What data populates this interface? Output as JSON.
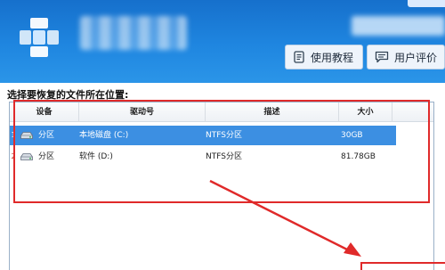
{
  "header": {
    "buttons": {
      "tutorial": "使用教程",
      "review": "用户评价"
    }
  },
  "main": {
    "prompt": "选择要恢复的文件所在位置:",
    "table": {
      "columns": [
        "设备",
        "驱动号",
        "描述",
        "大小"
      ],
      "rows": [
        {
          "index": "1",
          "device": "分区",
          "drive": "本地磁盘 (C:)",
          "description": "NTFS分区",
          "size": "30GB",
          "selected": true
        },
        {
          "index": "2",
          "device": "分区",
          "drive": "软件 (D:)",
          "description": "NTFS分区",
          "size": "81.78GB",
          "selected": false
        }
      ]
    }
  },
  "colors": {
    "header_blue": "#1f86e0",
    "selection_blue": "#3c8fe2",
    "annotation_red": "#e02a2a"
  },
  "icons": [
    "app-logo-icon",
    "book-icon",
    "chat-icon",
    "disk-icon"
  ]
}
